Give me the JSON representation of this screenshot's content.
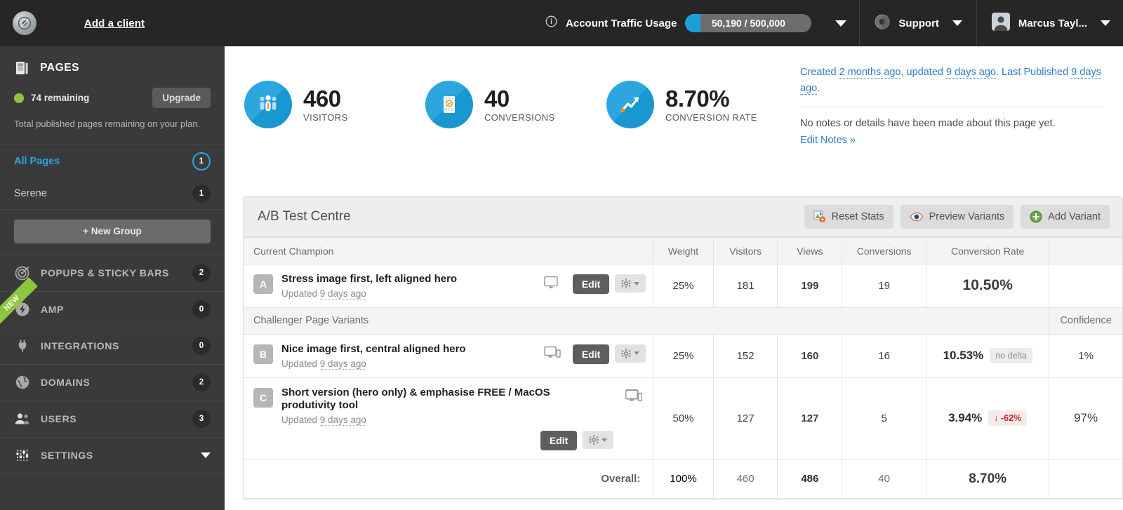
{
  "topbar": {
    "logo_icon": "leaf-circle-logo",
    "add_client": "Add a client",
    "info_icon": "info-icon",
    "traffic_label": "Account Traffic Usage",
    "traffic_value": "50,190 / 500,000",
    "traffic_caret_icon": "chevron-down-icon",
    "support_label": "Support",
    "support_icon": "lifebuoy-icon",
    "support_caret_icon": "chevron-down-icon",
    "user_name": "Marcus Tayl...",
    "avatar_icon": "user-avatar-icon",
    "user_caret_icon": "chevron-down-icon"
  },
  "sidebar": {
    "pages_icon": "pages-icon",
    "pages_title": "PAGES",
    "remaining_label": "74 remaining",
    "status_dot_color": "#8cc63f",
    "upgrade_label": "Upgrade",
    "plan_note": "Total published pages remaining on your plan.",
    "groups": [
      {
        "label": "All Pages",
        "count": "1",
        "active": true
      },
      {
        "label": "Serene",
        "count": "1",
        "active": false
      }
    ],
    "new_group_label": "+ New Group",
    "nav": [
      {
        "label": "POPUPS & STICKY BARS",
        "count": "2",
        "icon": "target-icon",
        "ribbon": ""
      },
      {
        "label": "AMP",
        "count": "0",
        "icon": "bolt-icon",
        "ribbon": "NEW"
      },
      {
        "label": "INTEGRATIONS",
        "count": "0",
        "icon": "plug-icon",
        "ribbon": ""
      },
      {
        "label": "DOMAINS",
        "count": "2",
        "icon": "globe-icon",
        "ribbon": ""
      },
      {
        "label": "USERS",
        "count": "3",
        "icon": "users-icon",
        "ribbon": ""
      },
      {
        "label": "SETTINGS",
        "count": "",
        "icon": "sliders-icon",
        "ribbon": ""
      }
    ]
  },
  "stats": [
    {
      "value": "460",
      "label": "VISITORS",
      "icon": "people-icon",
      "color": "#1a9fdc"
    },
    {
      "value": "40",
      "label": "CONVERSIONS",
      "icon": "form-check-icon",
      "color": "#1a9fdc"
    },
    {
      "value": "8.70%",
      "label": "CONVERSION RATE",
      "icon": "trend-up-icon",
      "color": "#1a9fdc"
    }
  ],
  "notes": {
    "meta_prefix": "Created ",
    "meta_created": "2 months ago",
    "meta_mid": ", updated ",
    "meta_updated": "9 days ago",
    "meta_mid2": ". Last Published ",
    "meta_published": "9 days ago",
    "meta_suffix": ".",
    "body": "No notes or details have been made about this page yet.",
    "edit_link": "Edit Notes »"
  },
  "panel": {
    "title": "A/B Test Centre",
    "buttons": [
      {
        "label": "Reset Stats",
        "icon": "reset-stats-icon"
      },
      {
        "label": "Preview Variants",
        "icon": "eye-icon"
      },
      {
        "label": "Add Variant",
        "icon": "plus-circle-icon"
      }
    ],
    "columns": {
      "champion": "Current Champion",
      "weight": "Weight",
      "visitors": "Visitors",
      "views": "Views",
      "conversions": "Conversions",
      "conversion_rate": "Conversion Rate",
      "blank": ""
    },
    "challenger_section": "Challenger Page Variants",
    "confidence_header": "Confidence",
    "edit_label": "Edit",
    "gear_icon": "gear-icon",
    "device_icon": "desktop-icon",
    "updated_prefix": "Updated ",
    "champion": {
      "letter": "A",
      "title": "Stress image first, left aligned hero",
      "updated": "9 days ago",
      "weight": "25%",
      "visitors": "181",
      "views": "199",
      "conversions": "19",
      "conversion_rate": "10.50%",
      "delta": "",
      "confidence": ""
    },
    "challengers": [
      {
        "letter": "B",
        "title": "Nice image first, central aligned hero",
        "updated": "9 days ago",
        "weight": "25%",
        "visitors": "152",
        "views": "160",
        "conversions": "16",
        "conversion_rate": "10.53%",
        "delta": "no delta",
        "delta_kind": "neutral",
        "confidence": "1%"
      },
      {
        "letter": "C",
        "title": "Short version (hero only) & emphasise FREE / MacOS produtivity tool",
        "updated": "9 days ago",
        "weight": "50%",
        "visitors": "127",
        "views": "127",
        "conversions": "5",
        "conversion_rate": "3.94%",
        "delta": "-62%",
        "delta_kind": "down",
        "confidence": "97%"
      }
    ],
    "overall": {
      "label": "Overall:",
      "weight": "100%",
      "visitors": "460",
      "views": "486",
      "conversions": "40",
      "conversion_rate": "8.70%",
      "confidence": ""
    }
  }
}
